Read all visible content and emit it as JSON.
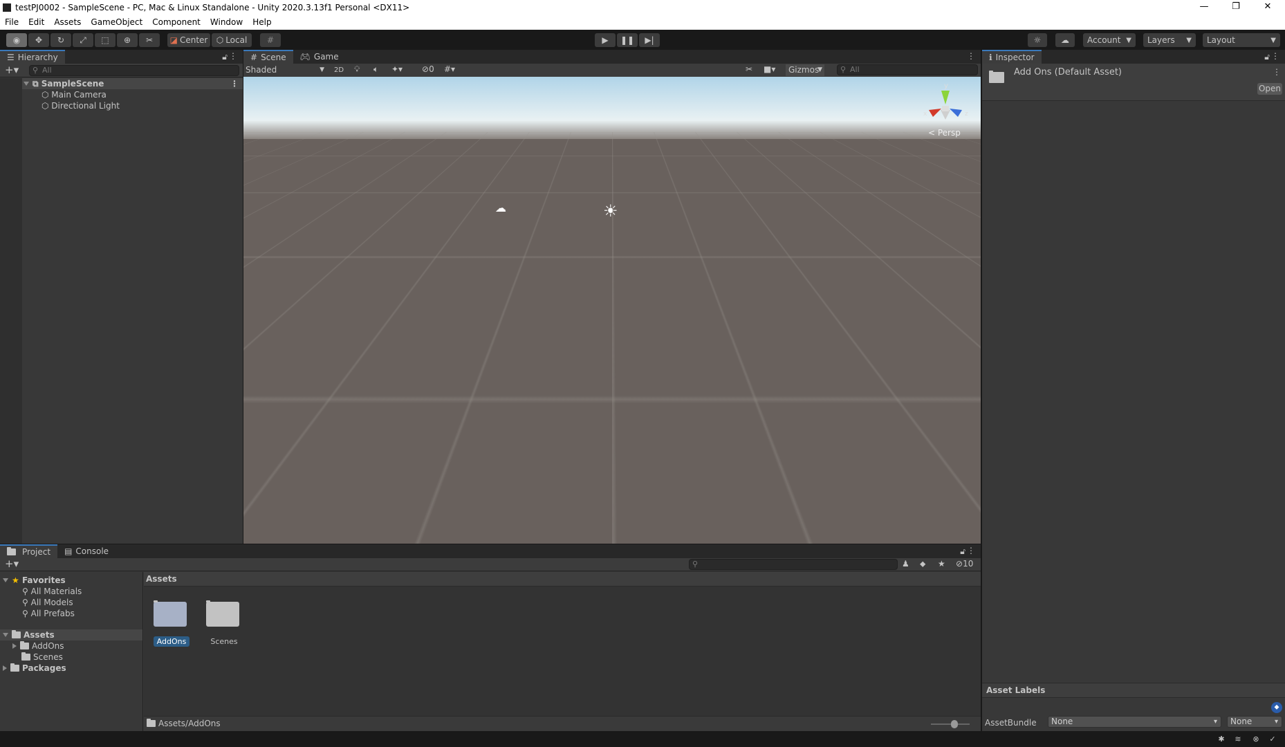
{
  "window": {
    "title": "testPJ0002 - SampleScene - PC, Mac & Linux Standalone - Unity 2020.3.13f1 Personal <DX11>",
    "minimize": "—",
    "restore": "❐",
    "close": "✕"
  },
  "menu": [
    "File",
    "Edit",
    "Assets",
    "GameObject",
    "Component",
    "Window",
    "Help"
  ],
  "toolbar": {
    "tools": [
      "view-tool",
      "move-tool",
      "rotate-tool",
      "scale-tool",
      "rect-tool",
      "transform-tool",
      "custom-tool"
    ],
    "pivot": "Center",
    "space": "Local",
    "account": "Account",
    "layers": "Layers",
    "layout": "Layout"
  },
  "hierarchy": {
    "tab": "Hierarchy",
    "search_placeholder": "All",
    "scene": "SampleScene",
    "items": [
      "Main Camera",
      "Directional Light"
    ]
  },
  "scene": {
    "tabs": [
      "Scene",
      "Game"
    ],
    "shading": "Shaded",
    "mode2d": "2D",
    "hidden_count": "0",
    "gizmos": "Gizmos",
    "search_placeholder": "All",
    "projection": "< Persp",
    "axes": {
      "y": "y",
      "x": "x",
      "z": "z"
    }
  },
  "inspector": {
    "tab": "Inspector",
    "asset_title": "Add Ons (Default Asset)",
    "open": "Open",
    "asset_labels": "Asset Labels",
    "assetbundle_label": "AssetBundle",
    "assetbundle_value": "None",
    "variant_value": "None"
  },
  "project": {
    "tabs": [
      "Project",
      "Console"
    ],
    "hidden_count": "10",
    "favorites": "Favorites",
    "favorite_items": [
      "All Materials",
      "All Models",
      "All Prefabs"
    ],
    "assets": "Assets",
    "asset_children": [
      "AddOns",
      "Scenes"
    ],
    "packages": "Packages",
    "grid_header": "Assets",
    "grid_items": [
      "AddOns",
      "Scenes"
    ],
    "path": "Assets/AddOns",
    "zoom_level": 0.6
  },
  "colors": {
    "accent": "#3a79bb",
    "selection": "#2c5d87",
    "panel": "#383838"
  }
}
